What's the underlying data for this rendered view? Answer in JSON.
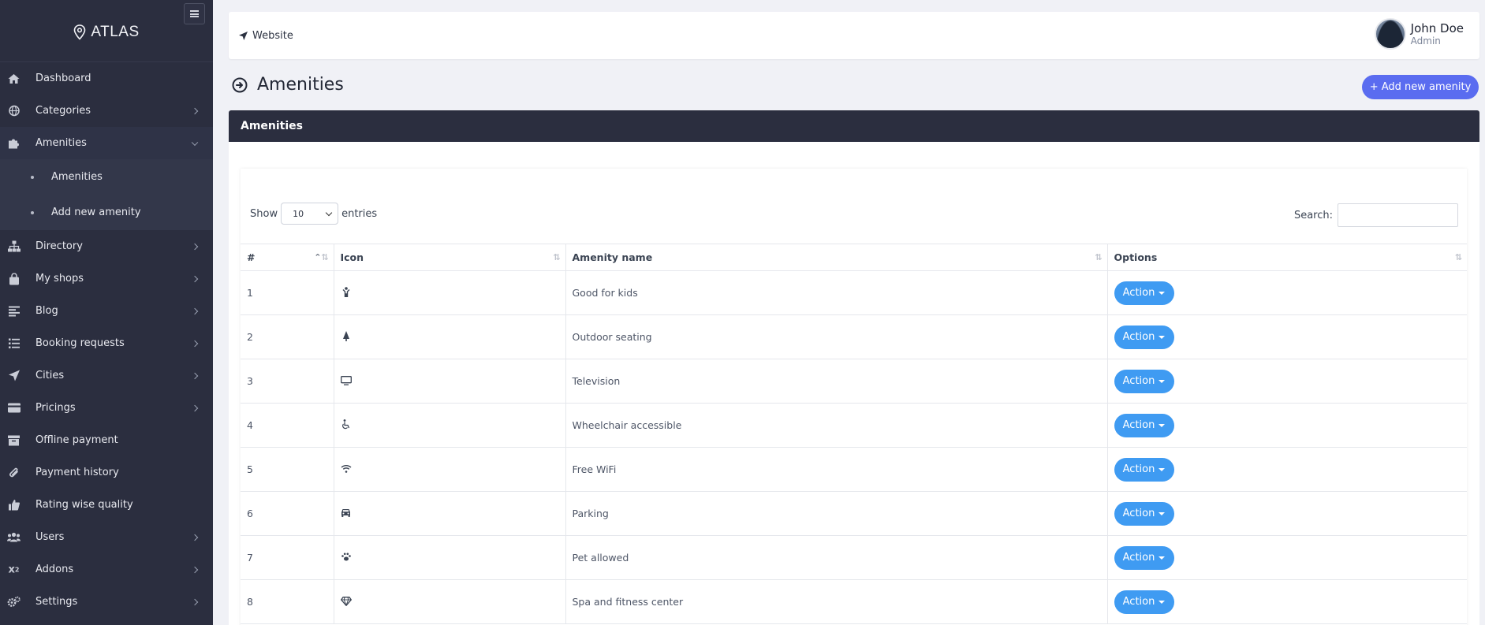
{
  "sidebar": {
    "brand": "ATLAS",
    "items": [
      {
        "label": "Dashboard",
        "icon": "home-icon",
        "has_children": false
      },
      {
        "label": "Categories",
        "icon": "globe-icon",
        "has_children": true
      },
      {
        "label": "Amenities",
        "icon": "puzzle-icon",
        "has_children": true,
        "expanded": true
      },
      {
        "label": "Directory",
        "icon": "sitemap-icon",
        "has_children": true
      },
      {
        "label": "My shops",
        "icon": "shopping-bag-icon",
        "has_children": true
      },
      {
        "label": "Blog",
        "icon": "align-left-icon",
        "has_children": true
      },
      {
        "label": "Booking requests",
        "icon": "list-icon",
        "has_children": true
      },
      {
        "label": "Cities",
        "icon": "paper-plane-icon",
        "has_children": true
      },
      {
        "label": "Pricings",
        "icon": "credit-card-icon",
        "has_children": true
      },
      {
        "label": "Offline payment",
        "icon": "archive-icon",
        "has_children": false
      },
      {
        "label": "Payment history",
        "icon": "paperclip-icon",
        "has_children": false
      },
      {
        "label": "Rating wise quality",
        "icon": "thumbs-up-icon",
        "has_children": false
      },
      {
        "label": "Users",
        "icon": "users-icon",
        "has_children": true
      },
      {
        "label": "Addons",
        "icon": "superscript-icon",
        "has_children": true
      },
      {
        "label": "Settings",
        "icon": "gears-icon",
        "has_children": true
      }
    ],
    "amenities_submenu": [
      "Amenities",
      "Add new amenity"
    ]
  },
  "header": {
    "website_label": "Website",
    "user_name": "John Doe",
    "user_role": "Admin"
  },
  "page": {
    "title": "Amenities",
    "add_button": "+ Add new amenity",
    "card_title": "Amenities"
  },
  "table_controls": {
    "show_label": "Show",
    "entries_value": "10",
    "entries_label": "entries",
    "search_label": "Search:"
  },
  "table": {
    "columns": [
      "#",
      "Icon",
      "Amenity name",
      "Options"
    ],
    "action_label": "Action",
    "rows": [
      {
        "num": "1",
        "icon": "child-icon",
        "name": "Good for kids"
      },
      {
        "num": "2",
        "icon": "tree-icon",
        "name": "Outdoor seating"
      },
      {
        "num": "3",
        "icon": "television-icon",
        "name": "Television"
      },
      {
        "num": "4",
        "icon": "wheelchair-icon",
        "name": "Wheelchair accessible"
      },
      {
        "num": "5",
        "icon": "wifi-icon",
        "name": "Free WiFi"
      },
      {
        "num": "6",
        "icon": "car-icon",
        "name": "Parking"
      },
      {
        "num": "7",
        "icon": "paw-icon",
        "name": "Pet allowed"
      },
      {
        "num": "8",
        "icon": "diamond-icon",
        "name": "Spa and fitness center"
      }
    ]
  },
  "colors": {
    "sidebar_bg": "#2b2e3f",
    "accent": "#5a6cf0",
    "action_button": "#3f9bf2"
  }
}
